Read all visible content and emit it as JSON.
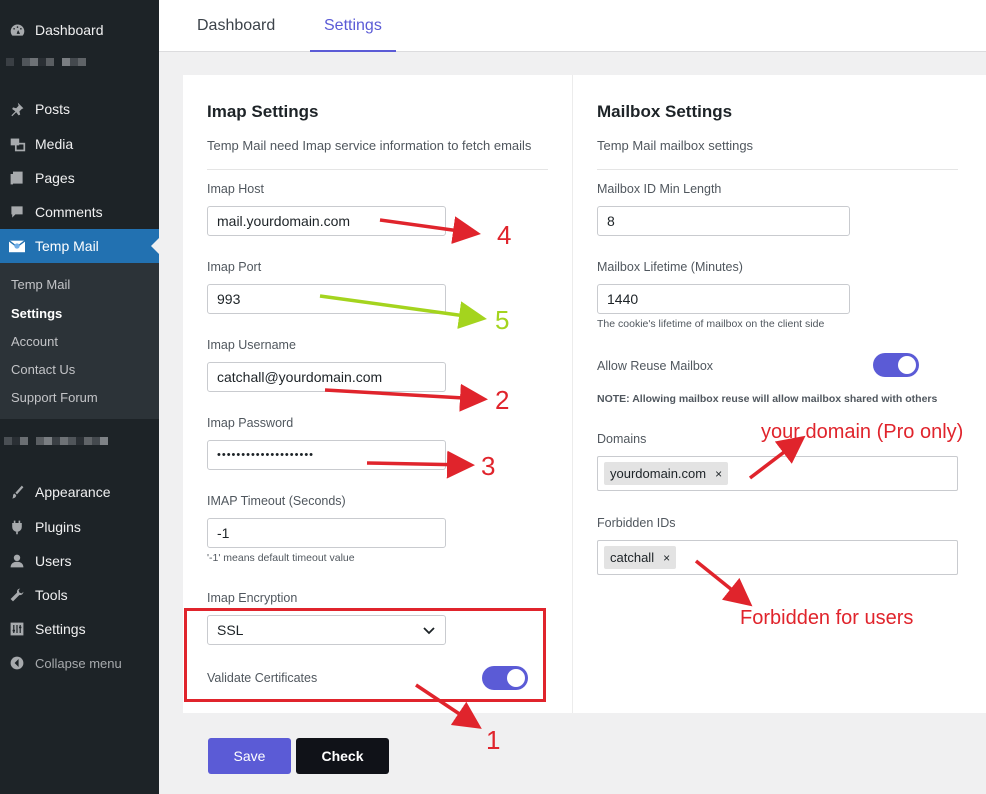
{
  "sidebar": {
    "items": [
      {
        "label": "Dashboard",
        "icon": "dashboard-icon"
      },
      {
        "label": "Posts",
        "icon": "pin-icon"
      },
      {
        "label": "Media",
        "icon": "media-icon"
      },
      {
        "label": "Pages",
        "icon": "pages-icon"
      },
      {
        "label": "Comments",
        "icon": "comments-icon"
      },
      {
        "label": "Temp Mail",
        "icon": "mail-icon"
      },
      {
        "label": "Appearance",
        "icon": "brush-icon"
      },
      {
        "label": "Plugins",
        "icon": "plug-icon"
      },
      {
        "label": "Users",
        "icon": "users-icon"
      },
      {
        "label": "Tools",
        "icon": "wrench-icon"
      },
      {
        "label": "Settings",
        "icon": "settings-icon"
      }
    ],
    "submenu": [
      "Temp Mail",
      "Settings",
      "Account",
      "Contact Us",
      "Support Forum"
    ],
    "collapse_label": "Collapse menu"
  },
  "tabs": [
    "Dashboard",
    "Settings"
  ],
  "imap": {
    "title": "Imap Settings",
    "description": "Temp Mail need Imap service information to fetch emails",
    "host_label": "Imap Host",
    "host_value": "mail.yourdomain.com",
    "port_label": "Imap Port",
    "port_value": "993",
    "username_label": "Imap Username",
    "username_value": "catchall@yourdomain.com",
    "password_label": "Imap Password",
    "password_value": "••••••••••••••••••••",
    "timeout_label": "IMAP Timeout (Seconds)",
    "timeout_value": "-1",
    "timeout_help": "'-1' means default timeout value",
    "encryption_label": "Imap Encryption",
    "encryption_value": "SSL",
    "validate_label": "Validate Certificates"
  },
  "mailbox": {
    "title": "Mailbox Settings",
    "description": "Temp Mail mailbox settings",
    "min_length_label": "Mailbox ID Min Length",
    "min_length_value": "8",
    "lifetime_label": "Mailbox Lifetime (Minutes)",
    "lifetime_value": "1440",
    "lifetime_help": "The cookie's lifetime of mailbox on the client side",
    "reuse_label": "Allow Reuse Mailbox",
    "reuse_note": "NOTE: Allowing mailbox reuse will allow mailbox shared with others",
    "domains_label": "Domains",
    "domains": [
      "yourdomain.com"
    ],
    "forbidden_label": "Forbidden IDs",
    "forbidden": [
      "catchall"
    ]
  },
  "buttons": {
    "save": "Save",
    "check": "Check"
  },
  "annotations": {
    "n1": "1",
    "n2": "2",
    "n3": "3",
    "n4": "4",
    "n5": "5",
    "domain_note": "your domain (Pro only)",
    "forbidden_note": "Forbidden for users"
  },
  "colors": {
    "accent": "#5b5bd6",
    "annotation_red": "#e0242c",
    "annotation_green": "#a4d41e",
    "sidebar": "#1d2327",
    "active_menu": "#2271b1"
  }
}
